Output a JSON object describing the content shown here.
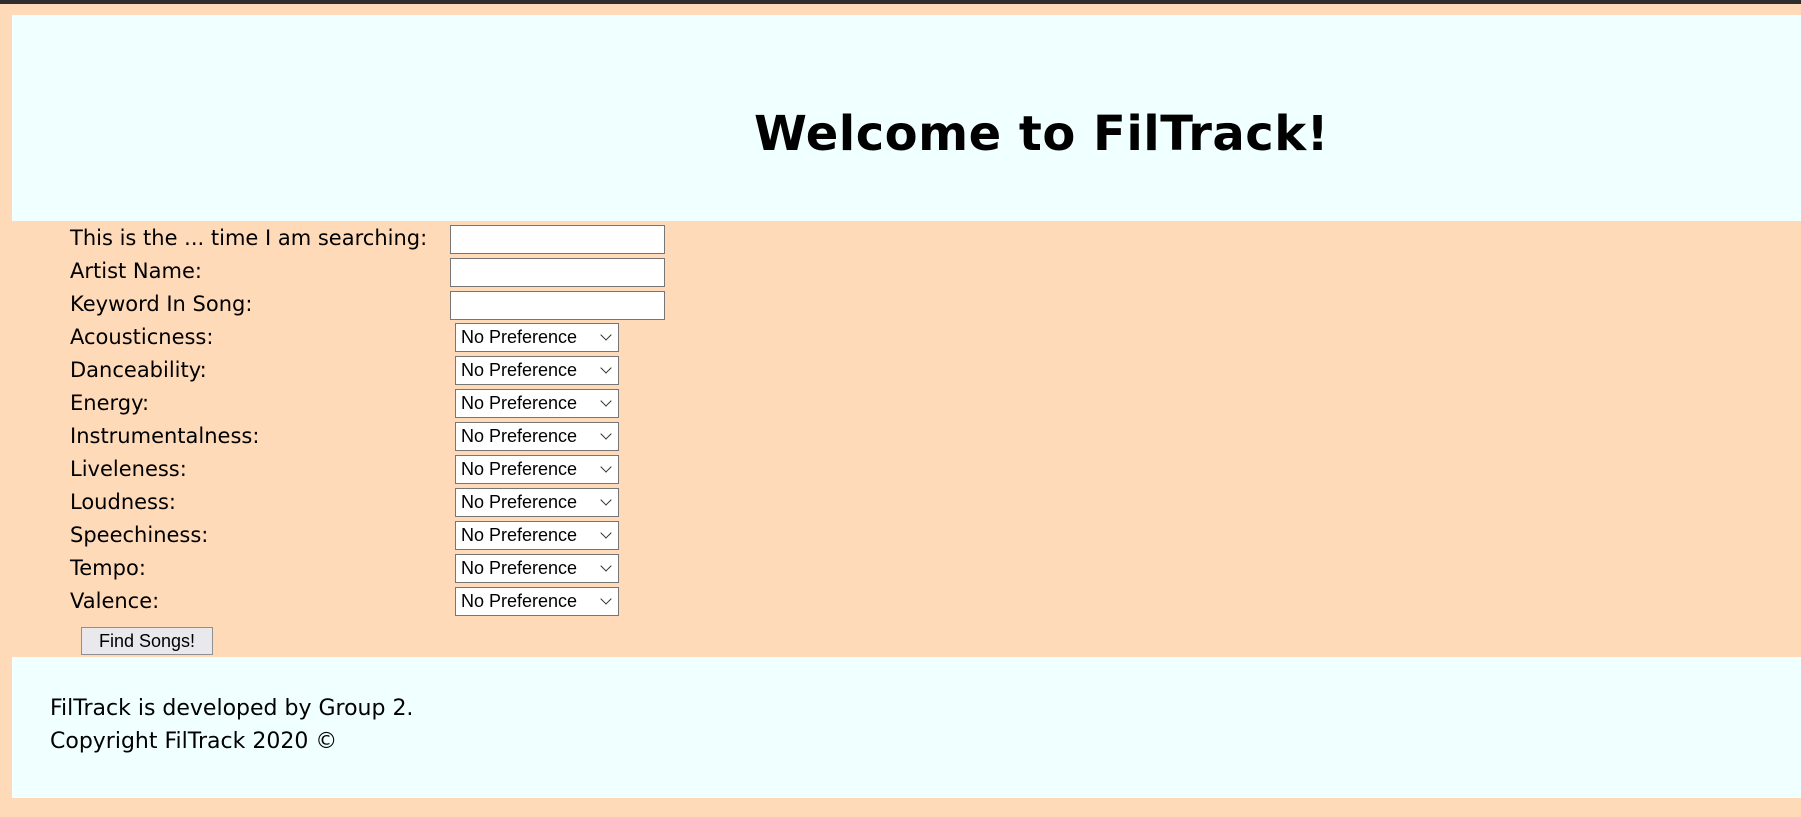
{
  "header": {
    "title": "Welcome to FilTrack!"
  },
  "form": {
    "text_fields": [
      {
        "label": "This is the ... time I am searching:",
        "value": ""
      },
      {
        "label": "Artist Name:",
        "value": ""
      },
      {
        "label": "Keyword In Song:",
        "value": ""
      }
    ],
    "select_fields": [
      {
        "label": "Acousticness:",
        "value": "No Preference"
      },
      {
        "label": "Danceability:",
        "value": "No Preference"
      },
      {
        "label": "Energy:",
        "value": "No Preference"
      },
      {
        "label": "Instrumentalness:",
        "value": "No Preference"
      },
      {
        "label": "Liveleness:",
        "value": "No Preference"
      },
      {
        "label": "Loudness:",
        "value": "No Preference"
      },
      {
        "label": "Speechiness:",
        "value": "No Preference"
      },
      {
        "label": "Tempo:",
        "value": "No Preference"
      },
      {
        "label": "Valence:",
        "value": "No Preference"
      }
    ],
    "submit_label": "Find Songs!"
  },
  "footer": {
    "line1": "FilTrack is developed by Group 2.",
    "line2": "Copyright FilTrack 2020 ©"
  },
  "colors": {
    "page_background": "#ffdab9",
    "panel_background": "#f0ffff"
  },
  "icons": {
    "select_arrow": "chevron-down-icon"
  }
}
